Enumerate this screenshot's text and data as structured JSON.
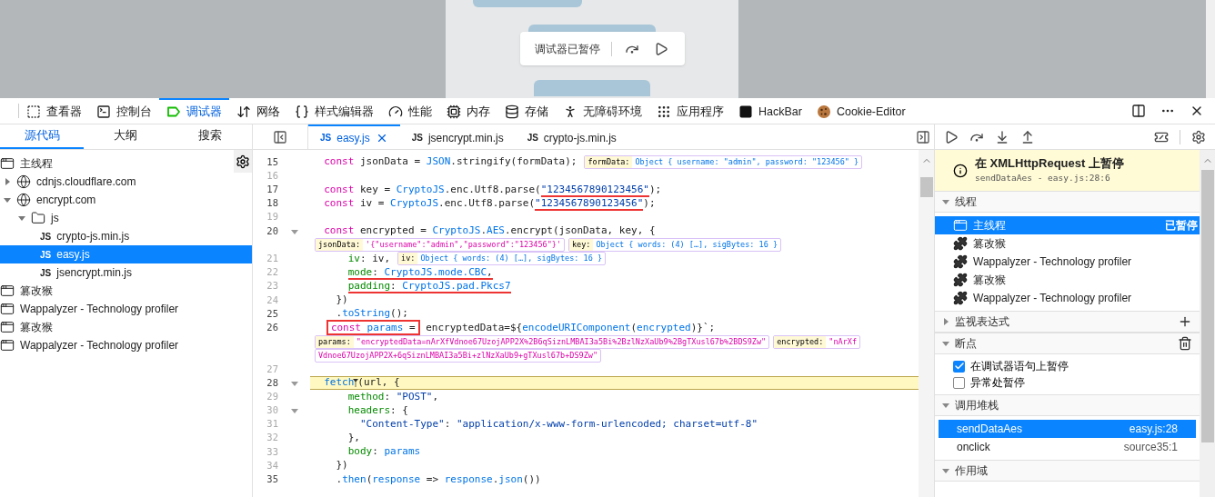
{
  "paused_overlay": {
    "label": "调试器已暂停"
  },
  "toolbar": {
    "tabs": [
      {
        "label": "查看器",
        "kind": "inspector",
        "selected": false
      },
      {
        "label": "控制台",
        "kind": "console",
        "selected": false
      },
      {
        "label": "调试器",
        "kind": "debugger",
        "selected": true
      },
      {
        "label": "网络",
        "kind": "network",
        "selected": false
      },
      {
        "label": "样式编辑器",
        "kind": "style",
        "selected": false
      },
      {
        "label": "性能",
        "kind": "performance",
        "selected": false
      },
      {
        "label": "内存",
        "kind": "memory",
        "selected": false
      },
      {
        "label": "存储",
        "kind": "storage",
        "selected": false
      },
      {
        "label": "无障碍环境",
        "kind": "accessibility",
        "selected": false
      },
      {
        "label": "应用程序",
        "kind": "application",
        "selected": false
      },
      {
        "label": "HackBar",
        "kind": "hackbar",
        "selected": false
      },
      {
        "label": "Cookie-Editor",
        "kind": "cookie",
        "selected": false
      }
    ]
  },
  "left_panel": {
    "tabs": [
      {
        "label": "源代码",
        "selected": true
      },
      {
        "label": "大纲",
        "selected": false
      },
      {
        "label": "搜索",
        "selected": false
      }
    ],
    "tree": [
      {
        "label": "主线程",
        "kind": "thread",
        "selected": false
      },
      {
        "label": "cdnjs.cloudflare.com",
        "kind": "domain",
        "expanded": false,
        "selected": false
      },
      {
        "label": "encrypt.com",
        "kind": "domain",
        "expanded": true,
        "selected": false,
        "children": [
          {
            "label": "js",
            "kind": "folder",
            "expanded": true,
            "selected": false,
            "children": [
              {
                "label": "crypto-js.min.js",
                "kind": "file",
                "badge": "JS",
                "selected": false
              },
              {
                "label": "easy.js",
                "kind": "file",
                "badge": "JS",
                "selected": true
              },
              {
                "label": "jsencrypt.min.js",
                "kind": "file",
                "badge": "JS",
                "selected": false
              }
            ]
          }
        ]
      },
      {
        "label": "篡改猴",
        "kind": "thread",
        "selected": false
      },
      {
        "label": "Wappalyzer - Technology profiler",
        "kind": "thread",
        "selected": false
      },
      {
        "label": "篡改猴",
        "kind": "thread",
        "selected": false
      },
      {
        "label": "Wappalyzer - Technology profiler",
        "kind": "thread",
        "selected": false
      }
    ]
  },
  "editor": {
    "tabs": [
      {
        "badge": "JS",
        "label": "easy.js",
        "selected": true,
        "closable": true
      },
      {
        "badge": "JS",
        "label": "jsencrypt.min.js",
        "selected": false,
        "closable": false
      },
      {
        "badge": "JS",
        "label": "crypto-js.min.js",
        "selected": false,
        "closable": false
      }
    ],
    "lines": [
      {
        "kind": "code",
        "number": "15",
        "breakable": true,
        "fold": false,
        "paused": false,
        "tokens": [
          {
            "text": "  const",
            "kind": "kw"
          },
          {
            "text": " jsonData = "
          },
          {
            "text": "JSON",
            "kind": "obj"
          },
          {
            "text": ".stringify(formData);"
          }
        ],
        "previews": [
          {
            "label": "formData:",
            "value": "Object { username: \"admin\", password: \"123456\" }",
            "kind": "object"
          }
        ]
      },
      {
        "kind": "code",
        "number": "16",
        "breakable": false,
        "fold": false,
        "paused": false
      },
      {
        "kind": "code",
        "number": "17",
        "breakable": true,
        "fold": false,
        "paused": false,
        "tokens": [
          {
            "text": "  const",
            "kind": "kw"
          },
          {
            "text": " key = "
          },
          {
            "text": "CryptoJS",
            "kind": "obj"
          },
          {
            "text": ".enc.Utf8.parse("
          },
          {
            "kind": "underlined",
            "tokens": [
              {
                "text": "\"1234567890123456\"",
                "kind": "str"
              }
            ]
          },
          {
            "text": ");"
          }
        ]
      },
      {
        "kind": "code",
        "number": "18",
        "breakable": true,
        "fold": false,
        "paused": false,
        "tokens": [
          {
            "text": "  const",
            "kind": "kw"
          },
          {
            "text": " iv = "
          },
          {
            "text": "CryptoJS",
            "kind": "obj"
          },
          {
            "text": ".enc.Utf8.parse("
          },
          {
            "kind": "underlined",
            "tokens": [
              {
                "text": "\"1234567890123456\"",
                "kind": "str"
              }
            ]
          },
          {
            "text": ");"
          }
        ]
      },
      {
        "kind": "code",
        "number": "19",
        "breakable": false,
        "fold": false,
        "paused": false
      },
      {
        "kind": "code",
        "number": "20",
        "breakable": true,
        "fold": true,
        "paused": false,
        "tokens": [
          {
            "text": "  const",
            "kind": "kw"
          },
          {
            "text": " encrypted = "
          },
          {
            "text": "CryptoJS",
            "kind": "obj"
          },
          {
            "text": "."
          },
          {
            "text": "AES",
            "kind": "obj"
          },
          {
            "text": ".encrypt(jsonData, key, {"
          }
        ]
      },
      {
        "kind": "preview",
        "chips": [
          {
            "label": "jsonData:",
            "value": "'{\"username\":\"admin\",\"password\":\"123456\"}'",
            "kind": "string"
          },
          {
            "label": "key:",
            "value": "Object { words: (4) […], sigBytes: 16 }",
            "kind": "object"
          }
        ]
      },
      {
        "kind": "code",
        "number": "21",
        "breakable": false,
        "fold": false,
        "paused": false,
        "tokens": [
          {
            "text": "      iv",
            "kind": "prop"
          },
          {
            "text": ": iv,"
          }
        ],
        "previews": [
          {
            "label": "iv:",
            "value": "Object { words: (4) […], sigBytes: 16 }",
            "kind": "object"
          }
        ]
      },
      {
        "kind": "code",
        "number": "22",
        "breakable": false,
        "fold": false,
        "paused": false,
        "tokens": [
          {
            "kind": "underlined",
            "tokens": [
              {
                "text": "      mode",
                "kind": "prop"
              },
              {
                "text": ": "
              },
              {
                "text": "CryptoJS.mode.CBC",
                "kind": "obj"
              },
              {
                "text": ","
              }
            ]
          }
        ]
      },
      {
        "kind": "code",
        "number": "23",
        "breakable": false,
        "fold": false,
        "paused": false,
        "tokens": [
          {
            "kind": "underlined",
            "tokens": [
              {
                "text": "      padding",
                "kind": "prop"
              },
              {
                "text": ": "
              },
              {
                "text": "CryptoJS.pad.Pkcs7",
                "kind": "obj"
              }
            ]
          }
        ]
      },
      {
        "kind": "code",
        "number": "24",
        "breakable": false,
        "fold": false,
        "paused": false,
        "tokens": [
          {
            "text": "    })"
          }
        ]
      },
      {
        "kind": "code",
        "number": "25",
        "breakable": true,
        "fold": false,
        "paused": false,
        "tokens": [
          {
            "text": "    ."
          },
          {
            "text": "toString",
            "kind": "obj"
          },
          {
            "text": "();"
          }
        ]
      },
      {
        "kind": "code",
        "number": "26",
        "breakable": true,
        "fold": false,
        "paused": false,
        "tokens": [
          {
            "kind": "boxed",
            "tokens": [
              {
                "text": "   const",
                "kind": "kw"
              },
              {
                "text": " params",
                "kind": "obj"
              },
              {
                "text": " ="
              }
            ]
          },
          {
            "text": " encryptedData=${"
          },
          {
            "text": "encodeURIComponent",
            "kind": "obj"
          },
          {
            "text": "("
          },
          {
            "text": "encrypted",
            "kind": "obj"
          },
          {
            "text": ")}`;"
          }
        ]
      },
      {
        "kind": "preview",
        "chips": [
          {
            "label": "params:",
            "value": "\"encryptedData=nArXfVdnoe67UzojAPP2X%2B6qSiznLMBAI3a5Bi%2BzlNzXaUb9%2BgTXusl67b%2BDS9Zw\"",
            "kind": "string"
          },
          {
            "label": "encrypted:",
            "value": "\"nArXf",
            "kind": "string"
          }
        ]
      },
      {
        "kind": "preview",
        "chips": [
          {
            "value": "Vdnoe67UzojAPP2X+6qSiznLMBAI3a5Bi+zlNzXaUb9+gTXusl67b+DS9Zw\"",
            "kind": "string"
          }
        ]
      },
      {
        "kind": "code",
        "number": "27",
        "breakable": false,
        "fold": false,
        "paused": false
      },
      {
        "kind": "code",
        "number": "28",
        "breakable": true,
        "fold": true,
        "paused": true,
        "tokens": [
          {
            "text": "  fetch",
            "kind": "obj"
          },
          {
            "text": "(url, {"
          }
        ]
      },
      {
        "kind": "code",
        "number": "29",
        "breakable": false,
        "fold": false,
        "paused": false,
        "tokens": [
          {
            "text": "      method",
            "kind": "prop"
          },
          {
            "text": ": "
          },
          {
            "text": "\"POST\"",
            "kind": "str"
          },
          {
            "text": ","
          }
        ]
      },
      {
        "kind": "code",
        "number": "30",
        "breakable": false,
        "fold": true,
        "paused": false,
        "tokens": [
          {
            "text": "      headers",
            "kind": "prop"
          },
          {
            "text": ": {"
          }
        ]
      },
      {
        "kind": "code",
        "number": "31",
        "breakable": false,
        "fold": false,
        "paused": false,
        "tokens": [
          {
            "text": "        \"Content-Type\"",
            "kind": "str"
          },
          {
            "text": ": "
          },
          {
            "text": "\"application/x-www-form-urlencoded; charset=utf-8\"",
            "kind": "str"
          }
        ]
      },
      {
        "kind": "code",
        "number": "32",
        "breakable": false,
        "fold": false,
        "paused": false,
        "tokens": [
          {
            "text": "      },"
          }
        ]
      },
      {
        "kind": "code",
        "number": "33",
        "breakable": false,
        "fold": false,
        "paused": false,
        "tokens": [
          {
            "text": "      body",
            "kind": "prop"
          },
          {
            "text": ": "
          },
          {
            "text": "params",
            "kind": "obj"
          }
        ]
      },
      {
        "kind": "code",
        "number": "34",
        "breakable": false,
        "fold": false,
        "paused": false,
        "tokens": [
          {
            "text": "    })"
          }
        ]
      },
      {
        "kind": "code",
        "number": "35",
        "breakable": true,
        "fold": false,
        "paused": false,
        "tokens": [
          {
            "text": "    ."
          },
          {
            "text": "then",
            "kind": "obj"
          },
          {
            "text": "("
          },
          {
            "text": "response",
            "kind": "obj"
          },
          {
            "text": " => "
          },
          {
            "text": "response",
            "kind": "obj"
          },
          {
            "text": "."
          },
          {
            "text": "json",
            "kind": "obj"
          },
          {
            "text": "())"
          }
        ]
      }
    ]
  },
  "debugger_panel": {
    "banner": {
      "title": "在 XMLHttpRequest 上暂停",
      "location": "sendDataAes - easy.js:28:6"
    },
    "sections": [
      {
        "title": "线程",
        "kind": "threads",
        "expanded": true,
        "items": [
          {
            "label": "主线程",
            "kind": "main",
            "selected": true,
            "status": "已暂停"
          },
          {
            "label": "篡改猴",
            "kind": "extension",
            "selected": false
          },
          {
            "label": "Wappalyzer - Technology profiler",
            "kind": "extension",
            "selected": false
          },
          {
            "label": "篡改猴",
            "kind": "extension",
            "selected": false
          },
          {
            "label": "Wappalyzer - Technology profiler",
            "kind": "extension",
            "selected": false
          }
        ]
      },
      {
        "title": "监视表达式",
        "kind": "watch",
        "expanded": false
      },
      {
        "title": "断点",
        "kind": "breakpoints",
        "expanded": true,
        "options": [
          {
            "label": "在调试器语句上暂停",
            "checked": true
          },
          {
            "label": "异常处暂停",
            "checked": false
          }
        ]
      },
      {
        "title": "调用堆栈",
        "kind": "stack",
        "expanded": true,
        "frames": [
          {
            "name": "sendDataAes",
            "location": "easy.js:28",
            "selected": true
          },
          {
            "name": "onclick",
            "location": "source35:1",
            "selected": false
          }
        ]
      },
      {
        "title": "作用域",
        "kind": "scopes",
        "expanded": true
      }
    ]
  }
}
